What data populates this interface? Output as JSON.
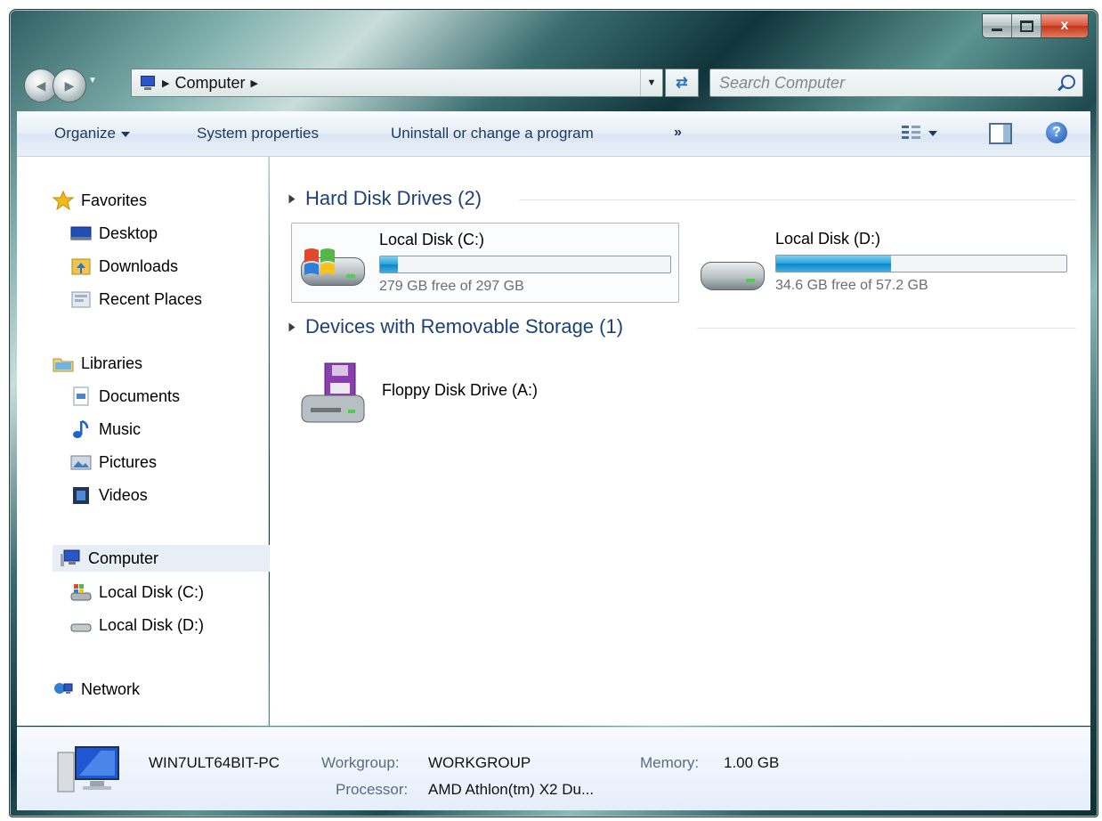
{
  "window": {
    "controls": {
      "minimize": "minimize",
      "maximize": "maximize",
      "close": "x"
    }
  },
  "navigation": {
    "address_segments": [
      "Computer"
    ],
    "search_placeholder": "Search Computer"
  },
  "toolbar": {
    "organize": "Organize",
    "system_properties": "System properties",
    "uninstall": "Uninstall or change a program",
    "more": "»"
  },
  "nav_pane": {
    "favorites": {
      "label": "Favorites",
      "items": [
        "Desktop",
        "Downloads",
        "Recent Places"
      ]
    },
    "libraries": {
      "label": "Libraries",
      "items": [
        "Documents",
        "Music",
        "Pictures",
        "Videos"
      ]
    },
    "computer": {
      "label": "Computer",
      "items": [
        "Local Disk (C:)",
        "Local Disk (D:)"
      ]
    },
    "network": {
      "label": "Network"
    }
  },
  "content": {
    "hard_disk_group": "Hard Disk Drives (2)",
    "drives": [
      {
        "name": "Local Disk (C:)",
        "free_text": "279 GB free of 297 GB",
        "used_fraction": 0.06
      },
      {
        "name": "Local Disk (D:)",
        "free_text": "34.6 GB free of 57.2 GB",
        "used_fraction": 0.395
      }
    ],
    "removable_group": "Devices with Removable Storage (1)",
    "removable": [
      {
        "name": "Floppy Disk Drive (A:)"
      }
    ]
  },
  "details": {
    "computer_name": "WIN7ULT64BIT-PC",
    "workgroup_label": "Workgroup:",
    "workgroup_value": "WORKGROUP",
    "memory_label": "Memory:",
    "memory_value": "1.00 GB",
    "processor_label": "Processor:",
    "processor_value": "AMD Athlon(tm) X2 Du..."
  },
  "icons": {
    "back": "back-arrow-icon",
    "forward": "forward-arrow-icon",
    "refresh": "refresh-icon",
    "search": "search-icon",
    "help": "help-icon"
  }
}
